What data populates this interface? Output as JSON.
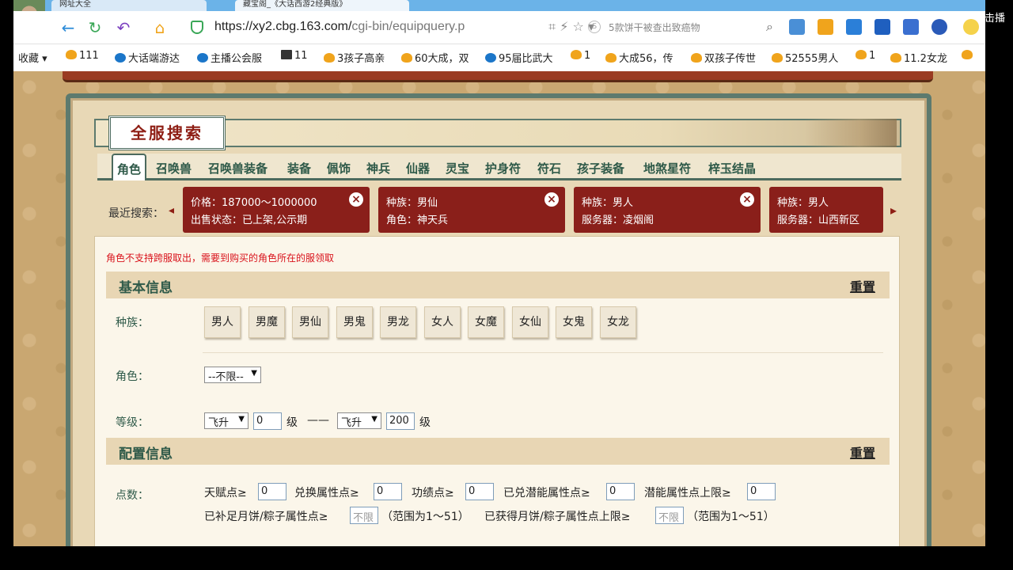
{
  "browser": {
    "tabs": [
      "网址大全",
      "藏宝阁_《大话西游2经典版》"
    ],
    "url_main": "https://xy2.cbg.163.com/",
    "url_rest": "cgi-bin/equipquery.p",
    "search_placeholder": "5款饼干被查出致癌物",
    "corner_text": "击播",
    "bookmarks": [
      "收藏",
      "111",
      "大话端游达",
      "主播公会服",
      "11",
      "3孩子高亲",
      "60大成，双",
      "95届比武大",
      "1",
      "大成56，传",
      "双孩子传世",
      "52555男人",
      "1",
      "11.2女龙"
    ]
  },
  "page": {
    "title": "全服搜索",
    "nav_tabs": [
      "角色",
      "召唤兽",
      "召唤兽装备",
      "装备",
      "佩饰",
      "神兵",
      "仙器",
      "灵宝",
      "护身符",
      "符石",
      "孩子装备",
      "地煞星符",
      "梓玉结晶"
    ],
    "recent_label": "最近搜索：",
    "recent": [
      {
        "line1": "价格：187000～1000000",
        "line2": "出售状态：已上架,公示期"
      },
      {
        "line1": "种族：男仙",
        "line2": "角色：神天兵"
      },
      {
        "line1": "种族：男人",
        "line2": "服务器：凌烟阁"
      },
      {
        "line1": "种族：男人",
        "line2": "服务器：山西新区"
      }
    ],
    "notice": "角色不支持跨服取出，需要到购买的角色所在的服领取",
    "basic": {
      "title": "基本信息",
      "reset": "重置",
      "race_label": "种族：",
      "races": [
        "男人",
        "男魔",
        "男仙",
        "男鬼",
        "男龙",
        "女人",
        "女魔",
        "女仙",
        "女鬼",
        "女龙"
      ],
      "role_label": "角色：",
      "role_value": "--不限--",
      "level_label": "等级：",
      "level_from_type": "飞升",
      "level_from": "0",
      "level_unit": "级",
      "dash": "——",
      "level_to_type": "飞升",
      "level_to": "200"
    },
    "config": {
      "title": "配置信息",
      "reset": "重置",
      "points_label": "点数：",
      "tianfu": "天赋点≥",
      "tianfu_val": "0",
      "duihuan": "兑换属性点≥",
      "duihuan_val": "0",
      "gongji": "功绩点≥",
      "gongji_val": "0",
      "qianneng": "已兑潜能属性点≥",
      "qianneng_val": "0",
      "qianneng_max": "潜能属性点上限≥",
      "qianneng_max_val": "0",
      "yuebing": "已补足月饼/粽子属性点≥",
      "nolimit": "不限",
      "range1": "（范围为1～51）",
      "yuebing_max": "已获得月饼/粽子属性点上限≥",
      "range2": "（范围为1～51）"
    }
  }
}
